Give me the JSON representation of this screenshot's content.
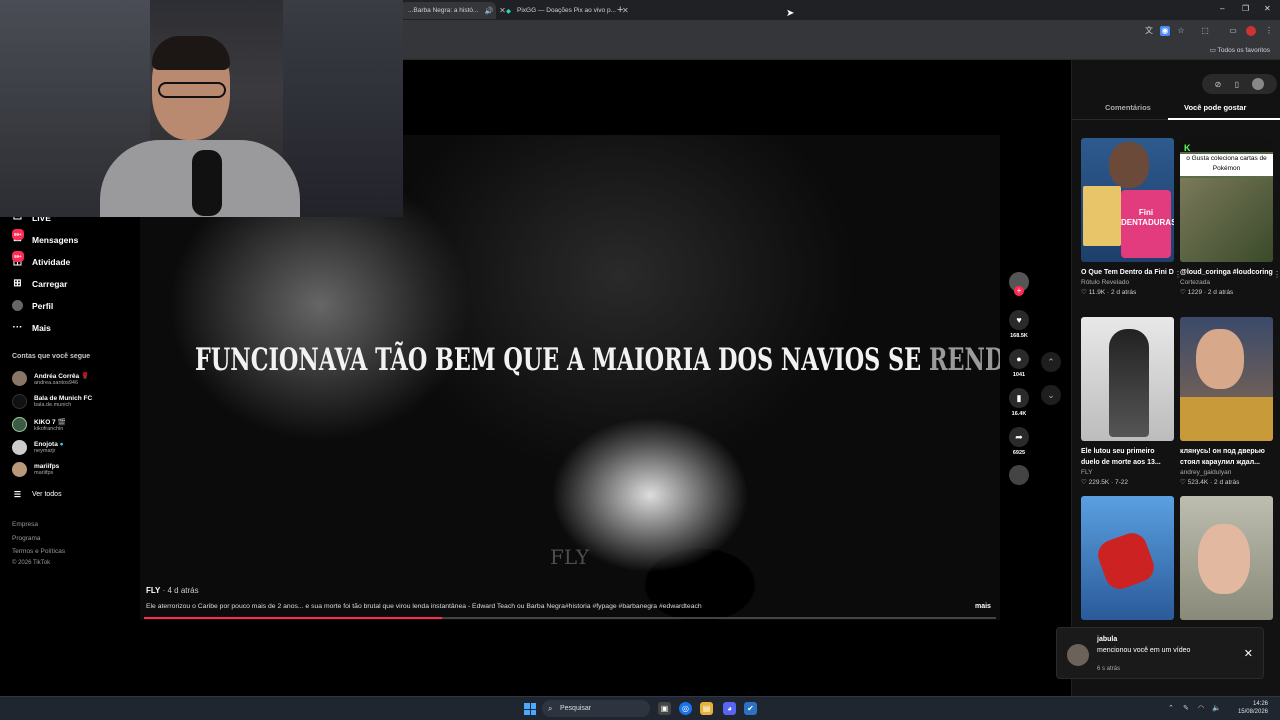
{
  "browser": {
    "tabs": [
      {
        "label": "...Barba Negra: a histó...",
        "active": true
      },
      {
        "label": "PixGG — Doações Pix ao vivo p...",
        "active": false
      }
    ],
    "bookmarks_label": "Todos os favoritos"
  },
  "nav": {
    "items": [
      {
        "label": "LIVE",
        "icon": "live-icon"
      },
      {
        "label": "Mensagens",
        "icon": "messages-icon",
        "badge": "99+"
      },
      {
        "label": "Atividade",
        "icon": "activity-icon",
        "badge": "99+"
      },
      {
        "label": "Carregar",
        "icon": "upload-icon"
      },
      {
        "label": "Perfil",
        "icon": "profile-icon"
      },
      {
        "label": "Mais",
        "icon": "more-icon"
      }
    ],
    "following_title": "Contas que você segue",
    "following": [
      {
        "name": "Andréa Corrêa 🌹",
        "user": "andrea.santos946"
      },
      {
        "name": "Bala de Munich FC",
        "user": "bala.de.munich"
      },
      {
        "name": "KIKO 7 🎬",
        "user": "kikofranchin"
      },
      {
        "name": "Enojota",
        "user": "neymarjr"
      },
      {
        "name": "mariifps",
        "user": "mariifps"
      }
    ],
    "see_all": "Ver todos",
    "footer": [
      "Empresa",
      "Programa",
      "Termos e Políticas",
      "© 2026 TikTok"
    ]
  },
  "video": {
    "headline_main": "FUNCIONAVA TÃO BEM QUE A MAIORIA DOS NAVIOS SE",
    "headline_dim": "RENDIA",
    "watermark": "FLY",
    "author": "FLY",
    "time": " · 4 d atrás",
    "caption": "Ele aterrorizou o Caribe por pouco mais de 2 anos... e sua morte foi tão brutal que virou lenda instantânea - Edward Teach ou Barba Negra#historia #fypage #barbanegra #edwardteach",
    "more_label": "mais",
    "progress": 0.35
  },
  "actions": {
    "likes": "168.5K",
    "comments": "1041",
    "saves": "16.4K",
    "shares": "6925"
  },
  "panel": {
    "tab_comments": "Comentários",
    "tab_like": "Você pode gostar",
    "cards": [
      {
        "title": "O Que Tem Dentro da Fini Dentaduras? 🦷...",
        "author": "Rótulo Revelado",
        "likes": "11.9K",
        "time": "2 d atrás",
        "thumb_text": "Fini DENTADURAS"
      },
      {
        "title": "@loud_coringa #loudcoringa...",
        "author": "Cortezada",
        "likes": "1229",
        "time": "2 d atrás",
        "thumb_text": "o Gusta coleciona cartas de Pokémon"
      },
      {
        "title": "Ele lutou seu primeiro duelo de morte aos 13...",
        "author": "FLY",
        "likes": "229.5K",
        "time": "7-22",
        "thumb_text": ""
      },
      {
        "title": "клянусь! он под дверью стоял караулил ждал...",
        "author": "andrey_gaidulyan",
        "likes": "523.4K",
        "time": "2 d atrás",
        "thumb_text": ""
      },
      {
        "title": "",
        "author": "",
        "likes": "",
        "time": "",
        "thumb_text": ""
      },
      {
        "title": "",
        "author": "",
        "likes": "",
        "time": "",
        "thumb_text": ""
      }
    ]
  },
  "notification": {
    "name": "jabula",
    "message": "mencionou você em um vídeo",
    "time": "6 s atrás"
  },
  "taskbar": {
    "search_placeholder": "Pesquisar",
    "time": "14:26",
    "date": "15/08/2026"
  }
}
